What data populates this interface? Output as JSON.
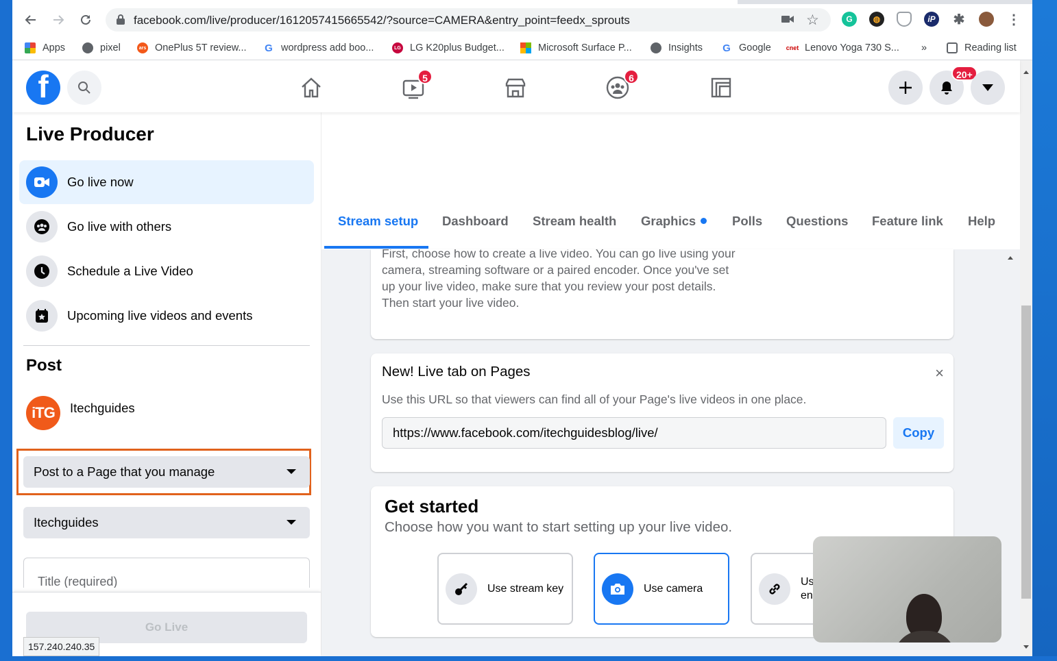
{
  "browser": {
    "url": "facebook.com/live/producer/1612057415665542/?source=CAMERA&entry_point=feedx_sprouts",
    "bookmarks": [
      {
        "label": "Apps",
        "icon": "apps-grid-icon"
      },
      {
        "label": "pixel",
        "icon": "apple-icon"
      },
      {
        "label": "OnePlus 5T review...",
        "icon": "ars-icon"
      },
      {
        "label": "wordpress add boo...",
        "icon": "google-icon"
      },
      {
        "label": "LG K20plus Budget...",
        "icon": "lg-icon"
      },
      {
        "label": "Microsoft Surface P...",
        "icon": "microsoft-icon"
      },
      {
        "label": "Insights",
        "icon": "globe-icon"
      },
      {
        "label": "Google",
        "icon": "google-icon"
      },
      {
        "label": "Lenovo Yoga 730 S...",
        "icon": "cnet-icon"
      }
    ],
    "more_bookmarks": "»",
    "reading_list": "Reading list",
    "status_ip": "157.240.240.35"
  },
  "fb_nav": {
    "watch_badge": "5",
    "groups_badge": "6",
    "notifications_badge": "20+"
  },
  "sidebar": {
    "title": "Live Producer",
    "items": [
      {
        "label": "Go live now",
        "icon": "live-camera-icon"
      },
      {
        "label": "Go live with others",
        "icon": "group-icon"
      },
      {
        "label": "Schedule a Live Video",
        "icon": "clock-icon"
      },
      {
        "label": "Upcoming live videos and events",
        "icon": "calendar-star-icon"
      }
    ],
    "post_heading": "Post",
    "page_name": "Itechguides",
    "avatar_text": "iTG",
    "post_target": "Post to a Page that you manage",
    "page_select": "Itechguides",
    "title_placeholder": "Title (required)",
    "go_live": "Go Live"
  },
  "tabs": [
    {
      "label": "Stream setup",
      "active": true
    },
    {
      "label": "Dashboard"
    },
    {
      "label": "Stream health"
    },
    {
      "label": "Graphics"
    },
    {
      "label": "Polls"
    },
    {
      "label": "Questions"
    },
    {
      "label": "Feature link"
    },
    {
      "label": "Help"
    }
  ],
  "intro": {
    "text": "First, choose how to create a live video. You can go live using your camera, streaming software or a paired encoder. Once you've set up your live video, make sure that you review your post details. Then start your live video."
  },
  "live_tab_card": {
    "title": "New! Live tab on Pages",
    "subtitle": "Use this URL so that viewers can find all of your Page's live videos in one place.",
    "url": "https://www.facebook.com/itechguidesblog/live/",
    "copy_label": "Copy",
    "close": "×"
  },
  "get_started": {
    "title": "Get started",
    "subtitle": "Choose how you want to start setting up your live video.",
    "options": [
      {
        "label": "Use stream key",
        "icon": "key-icon"
      },
      {
        "label": "Use camera",
        "icon": "camera-icon",
        "selected": true
      },
      {
        "label": "Use paired encoder",
        "icon": "link-icon",
        "visible_text": "Us en"
      }
    ]
  },
  "colors": {
    "fb_blue": "#1877f2",
    "highlight_orange": "#e1621c",
    "badge_red": "#e41e3f"
  }
}
